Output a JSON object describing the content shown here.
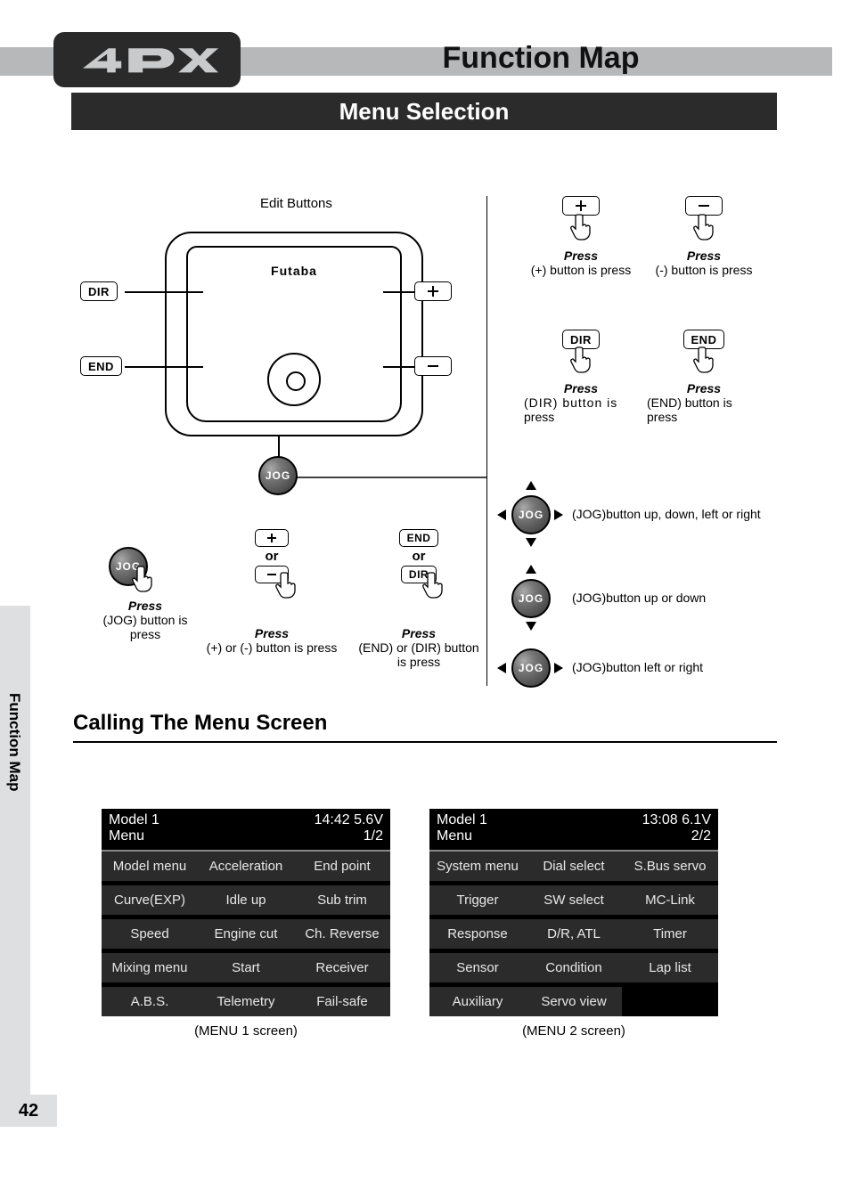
{
  "logo_text": "4PX",
  "title": "Function Map",
  "subtitle": "Menu Selection",
  "side_tab": "Function Map",
  "page_number": "42",
  "edit_buttons_label": "Edit Buttons",
  "device_brand": "Futaba",
  "labels": {
    "dir": "DIR",
    "end": "END",
    "jog": "JOG",
    "or": "or",
    "press": "Press",
    "plus_caption": "(+) button is press",
    "minus_caption": "(-) button is press",
    "dir_caption_1": "(DIR) button is",
    "dir_caption_2": "press",
    "end_caption_1": "(END) button is",
    "end_caption_2": "press",
    "jog_press_caption": "(JOG) button is press",
    "plus_or_minus_caption": "(+) or (-)  button is press",
    "end_or_dir_caption_1": "(END) or (DIR)  button",
    "end_or_dir_caption_2": "is press",
    "jog_udlr": "(JOG)button up, down, left or right",
    "jog_ud": "(JOG)button up or down",
    "jog_lr": "(JOG)button left or right"
  },
  "section_heading": "Calling The Menu Screen",
  "menus": [
    {
      "model": "Model 1",
      "menu_label": "Menu",
      "time": "14:42",
      "voltage": "5.6V",
      "page": "1/2",
      "caption": "(MENU 1 screen)",
      "cells": [
        "Model menu",
        "Acceleration",
        "End point",
        "Curve(EXP)",
        "Idle up",
        "Sub trim",
        "Speed",
        "Engine cut",
        "Ch. Reverse",
        "Mixing menu",
        "Start",
        "Receiver",
        "A.B.S.",
        "Telemetry",
        "Fail-safe"
      ]
    },
    {
      "model": "Model 1",
      "menu_label": "Menu",
      "time": "13:08",
      "voltage": "6.1V",
      "page": "2/2",
      "caption": "(MENU 2 screen)",
      "cells": [
        "System menu",
        "Dial select",
        "S.Bus servo",
        "Trigger",
        "SW select",
        "MC-Link",
        "Response",
        "D/R, ATL",
        "Timer",
        "Sensor",
        "Condition",
        "Lap list",
        "Auxiliary",
        "Servo view",
        ""
      ]
    }
  ]
}
